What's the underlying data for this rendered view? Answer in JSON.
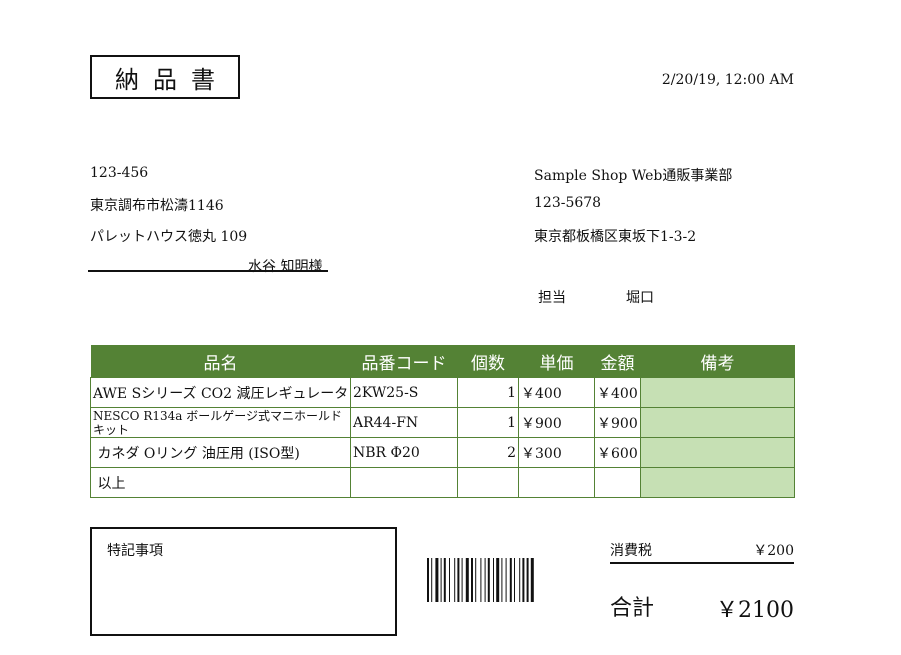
{
  "document": {
    "title": "納品書",
    "date": "2/20/19, 12:00 AM"
  },
  "recipient": {
    "postal": "123-456",
    "address1": "東京調布市松濤1146",
    "address2": "パレットハウス徳丸 109",
    "name": "水谷 知明様"
  },
  "sender": {
    "company": "Sample Shop Web通販事業部",
    "postal": "123-5678",
    "address": "東京都板橋区東坂下1-3-2",
    "contact_label": "担当",
    "contact_name": "堀口"
  },
  "table": {
    "headers": [
      "品名",
      "品番コード",
      "個数",
      "単価",
      "金額",
      "備考"
    ],
    "rows": [
      {
        "name": "AWE Sシリーズ CO2 減圧レギュレータ",
        "code": "2KW25-S",
        "qty": "1",
        "unit": "￥400",
        "amount": "￥400",
        "note": ""
      },
      {
        "name": "NESCO R134a ボールゲージ式マニホールドキット",
        "code": "AR44-FN",
        "qty": "1",
        "unit": "￥900",
        "amount": "￥900",
        "note": ""
      },
      {
        "name": " カネダ Oリング 油圧用 (ISO型)",
        "code": "NBR Φ20",
        "qty": "2",
        "unit": "￥300",
        "amount": "￥600",
        "note": ""
      },
      {
        "name": " 以上",
        "code": "",
        "qty": "",
        "unit": "",
        "amount": "",
        "note": ""
      }
    ]
  },
  "memo": {
    "label": "特記事項"
  },
  "summary": {
    "tax_label": "消費税",
    "tax_value": "￥200",
    "total_label": "合計",
    "total_value": "￥2100"
  },
  "icons": {
    "barcode": "barcode-icon"
  }
}
